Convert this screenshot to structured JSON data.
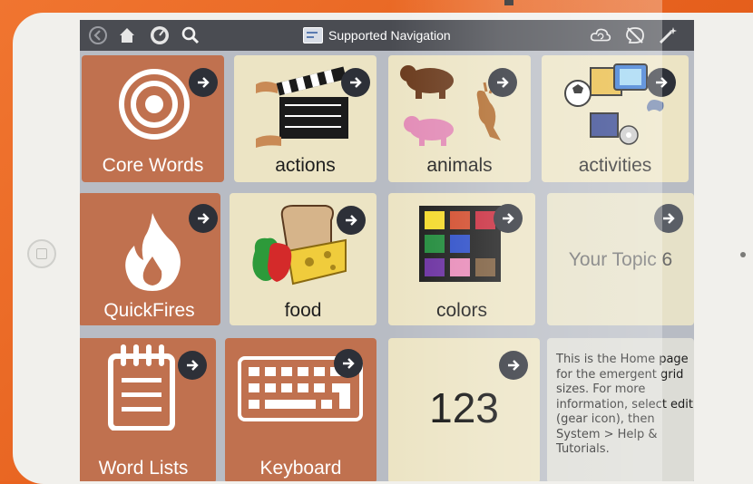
{
  "toolbar": {
    "title": "Supported Navigation",
    "icons": [
      "back-arrow-icon",
      "home-icon",
      "dashboard-gauge-icon",
      "search-icon",
      "cloud-sync-icon",
      "speech-off-icon",
      "edit-wand-icon"
    ]
  },
  "tiles": {
    "core_words": {
      "label": "Core Words",
      "icon": "target-icon"
    },
    "actions": {
      "label": "actions",
      "icon": "clapperboard-icon"
    },
    "animals": {
      "label": "animals",
      "icon": "animals-icon"
    },
    "activities": {
      "label": "activities",
      "icon": "activities-icon"
    },
    "quickfires": {
      "label": "QuickFires",
      "icon": "flame-icon"
    },
    "food": {
      "label": "food",
      "icon": "food-icon"
    },
    "colors": {
      "label": "colors",
      "icon": "color-swatches-icon"
    },
    "your_topic": {
      "label": "Your Topic 6"
    },
    "word_lists": {
      "label": "Word Lists",
      "icon": "notepad-icon"
    },
    "keyboard": {
      "label": "Keyboard",
      "icon": "keyboard-icon"
    },
    "numbers": {
      "label": "123"
    },
    "help_note": {
      "lines": [
        "This is the Home page",
        "for the emergent grid",
        "sizes. For more",
        "information, select edit",
        "(gear icon), then",
        "System > Help &",
        "Tutorials."
      ]
    }
  },
  "colors": {
    "orange_tile": "#c0714f",
    "cream_tile": "#ece4c4",
    "toolbar": "#4a4c52",
    "arrow_badge": "#2d3038",
    "case": "#e9631f"
  }
}
